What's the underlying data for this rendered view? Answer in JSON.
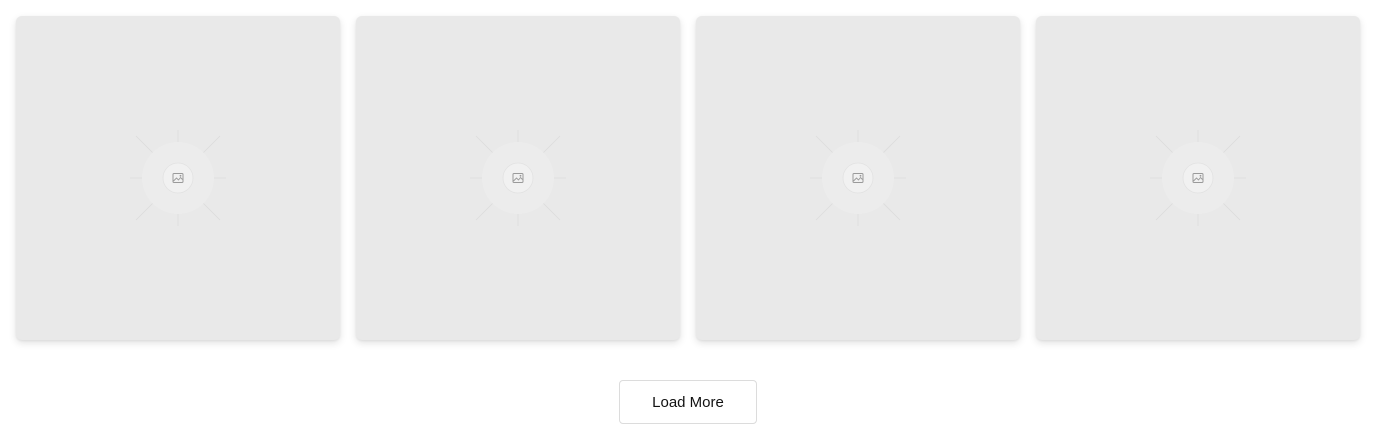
{
  "gallery": {
    "items": [
      {
        "icon": "image-placeholder-icon"
      },
      {
        "icon": "image-placeholder-icon"
      },
      {
        "icon": "image-placeholder-icon"
      },
      {
        "icon": "image-placeholder-icon"
      }
    ]
  },
  "load_more": {
    "label": "Load More"
  },
  "colors": {
    "card_background": "#e9e9e9",
    "page_background": "#ffffff",
    "button_border": "#dcdcdc"
  }
}
